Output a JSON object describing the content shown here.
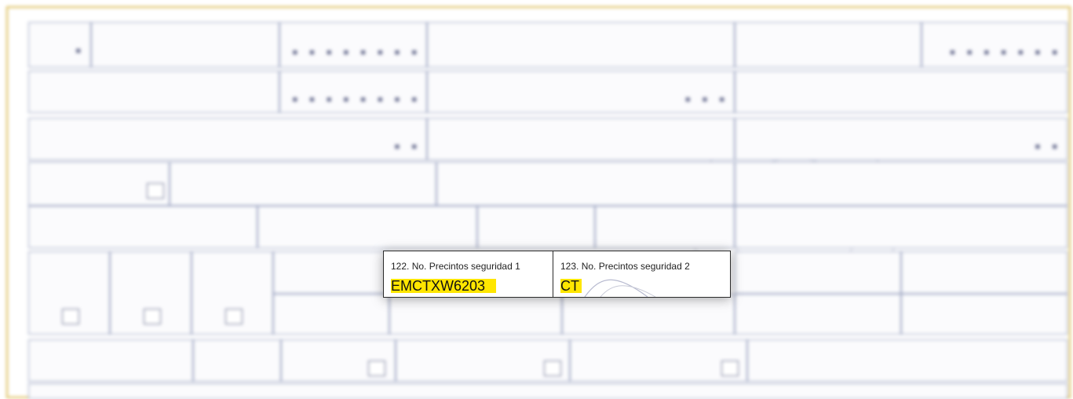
{
  "overlay": {
    "cells": [
      {
        "label": "122. No. Precintos seguridad 1",
        "value": "EMCTXW6203",
        "highlight_color": "#ffe600"
      },
      {
        "label": "123. No. Precintos seguridad 2",
        "value": "CT",
        "highlight_color": "#ffe600"
      }
    ]
  },
  "colors": {
    "frame_border": "#d9b84a",
    "cell_border": "#9aa3c0",
    "highlight": "#ffe600"
  }
}
